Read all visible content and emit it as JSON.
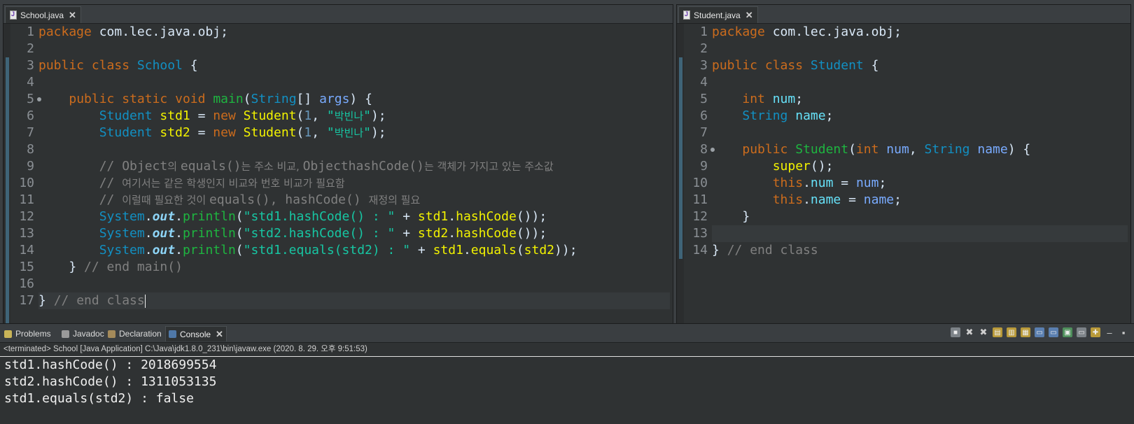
{
  "left_editor": {
    "tab_title": "School.java",
    "lines": [
      [
        {
          "t": "package",
          "c": "kw"
        },
        {
          "t": " com.lec.java.obj;"
        }
      ],
      [],
      [
        {
          "t": "public",
          "c": "kw"
        },
        {
          "t": " "
        },
        {
          "t": "class",
          "c": "kw"
        },
        {
          "t": " "
        },
        {
          "t": "School",
          "c": "ty"
        },
        {
          "t": " {"
        }
      ],
      [],
      [
        {
          "t": "    "
        },
        {
          "t": "public",
          "c": "kw"
        },
        {
          "t": " "
        },
        {
          "t": "static",
          "c": "kw"
        },
        {
          "t": " "
        },
        {
          "t": "void",
          "c": "kw"
        },
        {
          "t": " "
        },
        {
          "t": "main",
          "c": "fn"
        },
        {
          "t": "("
        },
        {
          "t": "String",
          "c": "ty"
        },
        {
          "t": "[] "
        },
        {
          "t": "args",
          "c": "pm"
        },
        {
          "t": ") {"
        }
      ],
      [
        {
          "t": "        "
        },
        {
          "t": "Student",
          "c": "ty"
        },
        {
          "t": " "
        },
        {
          "t": "std1",
          "c": "vr"
        },
        {
          "t": " = "
        },
        {
          "t": "new",
          "c": "kw"
        },
        {
          "t": " "
        },
        {
          "t": "Student",
          "c": "vr"
        },
        {
          "t": "("
        },
        {
          "t": "1",
          "c": "nm"
        },
        {
          "t": ", "
        },
        {
          "t": "\"",
          "c": "st"
        },
        {
          "t": "박빈나",
          "c": "st ko"
        },
        {
          "t": "\"",
          "c": "st"
        },
        {
          "t": ");"
        }
      ],
      [
        {
          "t": "        "
        },
        {
          "t": "Student",
          "c": "ty"
        },
        {
          "t": " "
        },
        {
          "t": "std2",
          "c": "vr"
        },
        {
          "t": " = "
        },
        {
          "t": "new",
          "c": "kw"
        },
        {
          "t": " "
        },
        {
          "t": "Student",
          "c": "vr"
        },
        {
          "t": "("
        },
        {
          "t": "1",
          "c": "nm"
        },
        {
          "t": ", "
        },
        {
          "t": "\"",
          "c": "st"
        },
        {
          "t": "박빈나",
          "c": "st ko"
        },
        {
          "t": "\"",
          "c": "st"
        },
        {
          "t": ");"
        }
      ],
      [],
      [
        {
          "t": "        // Object",
          "c": "cm"
        },
        {
          "t": "의 ",
          "c": "cm ko"
        },
        {
          "t": "equals()",
          "c": "cm"
        },
        {
          "t": "는 주소 비교, ",
          "c": "cm ko"
        },
        {
          "t": "ObjecthashCode()",
          "c": "cm"
        },
        {
          "t": "는 객체가 가지고 있는 주소값",
          "c": "cm ko"
        }
      ],
      [
        {
          "t": "        // ",
          "c": "cm"
        },
        {
          "t": "여기서는 같은 학생인지 비교와 번호 비교가 필요함",
          "c": "cm ko"
        }
      ],
      [
        {
          "t": "        // ",
          "c": "cm"
        },
        {
          "t": "이럴때 필요한 것이 ",
          "c": "cm ko"
        },
        {
          "t": "equals(), hashCode() ",
          "c": "cm"
        },
        {
          "t": "재정의 필요",
          "c": "cm ko"
        }
      ],
      [
        {
          "t": "        "
        },
        {
          "t": "System",
          "c": "ty"
        },
        {
          "t": "."
        },
        {
          "t": "out",
          "c": "so"
        },
        {
          "t": "."
        },
        {
          "t": "println",
          "c": "fn"
        },
        {
          "t": "("
        },
        {
          "t": "\"std1.hashCode() : \"",
          "c": "st"
        },
        {
          "t": " + "
        },
        {
          "t": "std1",
          "c": "vr"
        },
        {
          "t": "."
        },
        {
          "t": "hashCode",
          "c": "vr"
        },
        {
          "t": "());"
        }
      ],
      [
        {
          "t": "        "
        },
        {
          "t": "System",
          "c": "ty"
        },
        {
          "t": "."
        },
        {
          "t": "out",
          "c": "so"
        },
        {
          "t": "."
        },
        {
          "t": "println",
          "c": "fn"
        },
        {
          "t": "("
        },
        {
          "t": "\"std2.hashCode() : \"",
          "c": "st"
        },
        {
          "t": " + "
        },
        {
          "t": "std2",
          "c": "vr"
        },
        {
          "t": "."
        },
        {
          "t": "hashCode",
          "c": "vr"
        },
        {
          "t": "());"
        }
      ],
      [
        {
          "t": "        "
        },
        {
          "t": "System",
          "c": "ty"
        },
        {
          "t": "."
        },
        {
          "t": "out",
          "c": "so"
        },
        {
          "t": "."
        },
        {
          "t": "println",
          "c": "fn"
        },
        {
          "t": "("
        },
        {
          "t": "\"std1.equals(std2) : \"",
          "c": "st"
        },
        {
          "t": " + "
        },
        {
          "t": "std1",
          "c": "vr"
        },
        {
          "t": "."
        },
        {
          "t": "equals",
          "c": "vr"
        },
        {
          "t": "("
        },
        {
          "t": "std2",
          "c": "vr"
        },
        {
          "t": "));"
        }
      ],
      [
        {
          "t": "    } "
        },
        {
          "t": "// end main()",
          "c": "cm"
        }
      ],
      [],
      [
        {
          "t": "} "
        },
        {
          "t": "// end class",
          "c": "cm"
        }
      ]
    ],
    "current_line": 17
  },
  "right_editor": {
    "tab_title": "Student.java",
    "lines": [
      [
        {
          "t": "package",
          "c": "kw"
        },
        {
          "t": " com.lec.java.obj;"
        }
      ],
      [],
      [
        {
          "t": "public",
          "c": "kw"
        },
        {
          "t": " "
        },
        {
          "t": "class",
          "c": "kw"
        },
        {
          "t": " "
        },
        {
          "t": "Student",
          "c": "ty"
        },
        {
          "t": " {"
        }
      ],
      [],
      [
        {
          "t": "    "
        },
        {
          "t": "int",
          "c": "kw"
        },
        {
          "t": " "
        },
        {
          "t": "num",
          "c": "fd"
        },
        {
          "t": ";"
        }
      ],
      [
        {
          "t": "    "
        },
        {
          "t": "String",
          "c": "ty"
        },
        {
          "t": " "
        },
        {
          "t": "name",
          "c": "fd"
        },
        {
          "t": ";"
        }
      ],
      [],
      [
        {
          "t": "    "
        },
        {
          "t": "public",
          "c": "kw"
        },
        {
          "t": " "
        },
        {
          "t": "Student",
          "c": "fn"
        },
        {
          "t": "("
        },
        {
          "t": "int",
          "c": "kw"
        },
        {
          "t": " "
        },
        {
          "t": "num",
          "c": "pm"
        },
        {
          "t": ", "
        },
        {
          "t": "String",
          "c": "ty"
        },
        {
          "t": " "
        },
        {
          "t": "name",
          "c": "pm"
        },
        {
          "t": ") {"
        }
      ],
      [
        {
          "t": "        "
        },
        {
          "t": "super",
          "c": "vr"
        },
        {
          "t": "();"
        }
      ],
      [
        {
          "t": "        "
        },
        {
          "t": "this",
          "c": "kw"
        },
        {
          "t": "."
        },
        {
          "t": "num",
          "c": "fd"
        },
        {
          "t": " = "
        },
        {
          "t": "num",
          "c": "pm"
        },
        {
          "t": ";"
        }
      ],
      [
        {
          "t": "        "
        },
        {
          "t": "this",
          "c": "kw"
        },
        {
          "t": "."
        },
        {
          "t": "name",
          "c": "fd"
        },
        {
          "t": " = "
        },
        {
          "t": "name",
          "c": "pm"
        },
        {
          "t": ";"
        }
      ],
      [
        {
          "t": "    }"
        }
      ],
      [],
      [
        {
          "t": "} "
        },
        {
          "t": "// end class",
          "c": "cm"
        }
      ]
    ],
    "current_line": 13
  },
  "console": {
    "tabs": [
      {
        "label": "Problems",
        "icon": "problems-icon",
        "color": "#c9b458"
      },
      {
        "label": "Javadoc",
        "icon": "javadoc-icon",
        "color": "#9a9a9a"
      },
      {
        "label": "Declaration",
        "icon": "declaration-icon",
        "color": "#a48a5a"
      },
      {
        "label": "Console",
        "icon": "console-icon",
        "color": "#4f78a8"
      }
    ],
    "active_tab": "Console",
    "status": "<terminated> School [Java Application] C:\\Java\\jdk1.8.0_231\\bin\\javaw.exe (2020. 8. 29. 오후 9:51:53)",
    "output": [
      "std1.hashCode() : 2018699554",
      "std2.hashCode() : 1311053135",
      "std1.equals(std2) : false"
    ],
    "toolbar": [
      {
        "icon": "terminate-icon",
        "style": "gray",
        "glyph": "■"
      },
      {
        "icon": "remove-launch-icon",
        "style": "flat",
        "glyph": "✖"
      },
      {
        "icon": "remove-all-terminated-icon",
        "style": "flat",
        "glyph": "✖"
      },
      {
        "icon": "clear-console-icon",
        "style": "yellow",
        "glyph": "▤"
      },
      {
        "icon": "scroll-lock-icon",
        "style": "yellow",
        "glyph": "▥"
      },
      {
        "icon": "word-wrap-icon",
        "style": "yellow",
        "glyph": "▦"
      },
      {
        "icon": "show-on-stdout-icon",
        "style": "blue",
        "glyph": "▭"
      },
      {
        "icon": "show-on-stderr-icon",
        "style": "blue",
        "glyph": "▭"
      },
      {
        "icon": "pin-console-icon",
        "style": "green",
        "glyph": "▣"
      },
      {
        "icon": "display-console-icon",
        "style": "gray",
        "glyph": "▭"
      },
      {
        "icon": "open-console-icon",
        "style": "yellow",
        "glyph": "✚"
      },
      {
        "icon": "minimize-icon",
        "style": "flat",
        "glyph": "–"
      },
      {
        "icon": "maximize-icon",
        "style": "flat",
        "glyph": "▪"
      }
    ]
  }
}
